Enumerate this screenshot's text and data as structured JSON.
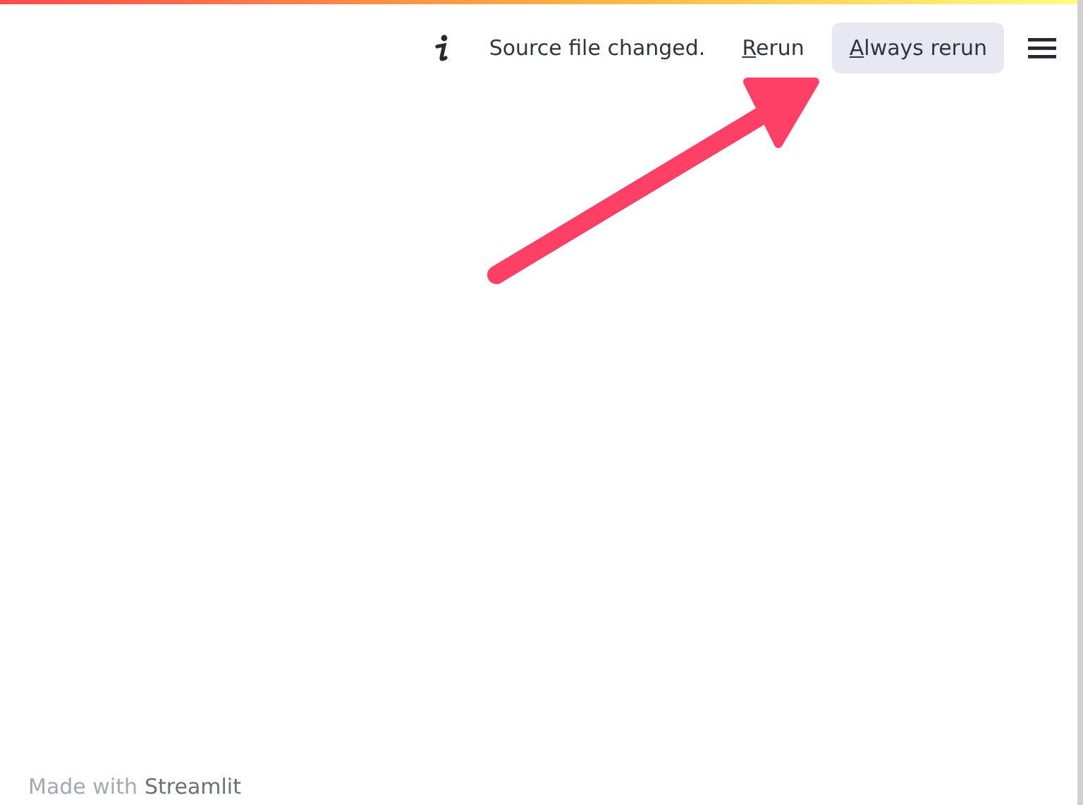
{
  "status": {
    "message": "Source file changed."
  },
  "buttons": [
    {
      "kind": "plain",
      "hotkey": "R",
      "label_rest": "erun"
    },
    {
      "kind": "filled",
      "hotkey": "A",
      "label_rest": "lways rerun"
    }
  ],
  "footer": {
    "prefix": "Made with",
    "brand": "Streamlit"
  }
}
